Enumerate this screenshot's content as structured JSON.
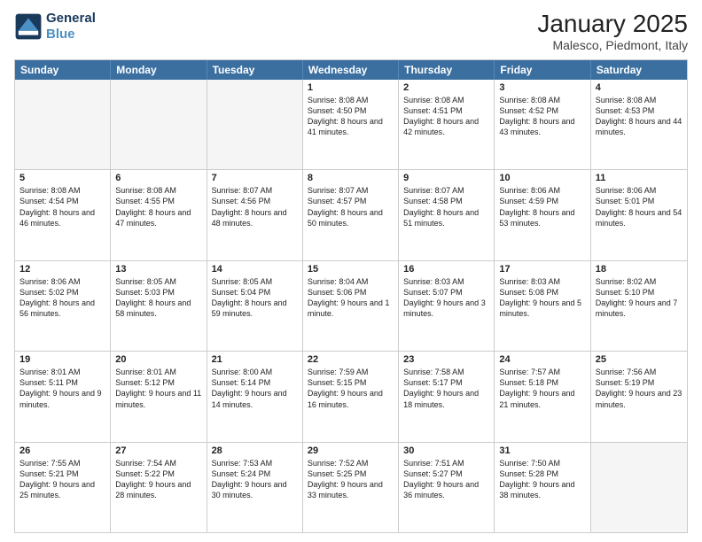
{
  "logo": {
    "line1": "General",
    "line2": "Blue"
  },
  "title": "January 2025",
  "subtitle": "Malesco, Piedmont, Italy",
  "weekdays": [
    "Sunday",
    "Monday",
    "Tuesday",
    "Wednesday",
    "Thursday",
    "Friday",
    "Saturday"
  ],
  "weeks": [
    [
      {
        "day": "",
        "info": "",
        "empty": true
      },
      {
        "day": "",
        "info": "",
        "empty": true
      },
      {
        "day": "",
        "info": "",
        "empty": true
      },
      {
        "day": "1",
        "info": "Sunrise: 8:08 AM\nSunset: 4:50 PM\nDaylight: 8 hours and 41 minutes."
      },
      {
        "day": "2",
        "info": "Sunrise: 8:08 AM\nSunset: 4:51 PM\nDaylight: 8 hours and 42 minutes."
      },
      {
        "day": "3",
        "info": "Sunrise: 8:08 AM\nSunset: 4:52 PM\nDaylight: 8 hours and 43 minutes."
      },
      {
        "day": "4",
        "info": "Sunrise: 8:08 AM\nSunset: 4:53 PM\nDaylight: 8 hours and 44 minutes."
      }
    ],
    [
      {
        "day": "5",
        "info": "Sunrise: 8:08 AM\nSunset: 4:54 PM\nDaylight: 8 hours and 46 minutes."
      },
      {
        "day": "6",
        "info": "Sunrise: 8:08 AM\nSunset: 4:55 PM\nDaylight: 8 hours and 47 minutes."
      },
      {
        "day": "7",
        "info": "Sunrise: 8:07 AM\nSunset: 4:56 PM\nDaylight: 8 hours and 48 minutes."
      },
      {
        "day": "8",
        "info": "Sunrise: 8:07 AM\nSunset: 4:57 PM\nDaylight: 8 hours and 50 minutes."
      },
      {
        "day": "9",
        "info": "Sunrise: 8:07 AM\nSunset: 4:58 PM\nDaylight: 8 hours and 51 minutes."
      },
      {
        "day": "10",
        "info": "Sunrise: 8:06 AM\nSunset: 4:59 PM\nDaylight: 8 hours and 53 minutes."
      },
      {
        "day": "11",
        "info": "Sunrise: 8:06 AM\nSunset: 5:01 PM\nDaylight: 8 hours and 54 minutes."
      }
    ],
    [
      {
        "day": "12",
        "info": "Sunrise: 8:06 AM\nSunset: 5:02 PM\nDaylight: 8 hours and 56 minutes."
      },
      {
        "day": "13",
        "info": "Sunrise: 8:05 AM\nSunset: 5:03 PM\nDaylight: 8 hours and 58 minutes."
      },
      {
        "day": "14",
        "info": "Sunrise: 8:05 AM\nSunset: 5:04 PM\nDaylight: 8 hours and 59 minutes."
      },
      {
        "day": "15",
        "info": "Sunrise: 8:04 AM\nSunset: 5:06 PM\nDaylight: 9 hours and 1 minute."
      },
      {
        "day": "16",
        "info": "Sunrise: 8:03 AM\nSunset: 5:07 PM\nDaylight: 9 hours and 3 minutes."
      },
      {
        "day": "17",
        "info": "Sunrise: 8:03 AM\nSunset: 5:08 PM\nDaylight: 9 hours and 5 minutes."
      },
      {
        "day": "18",
        "info": "Sunrise: 8:02 AM\nSunset: 5:10 PM\nDaylight: 9 hours and 7 minutes."
      }
    ],
    [
      {
        "day": "19",
        "info": "Sunrise: 8:01 AM\nSunset: 5:11 PM\nDaylight: 9 hours and 9 minutes."
      },
      {
        "day": "20",
        "info": "Sunrise: 8:01 AM\nSunset: 5:12 PM\nDaylight: 9 hours and 11 minutes."
      },
      {
        "day": "21",
        "info": "Sunrise: 8:00 AM\nSunset: 5:14 PM\nDaylight: 9 hours and 14 minutes."
      },
      {
        "day": "22",
        "info": "Sunrise: 7:59 AM\nSunset: 5:15 PM\nDaylight: 9 hours and 16 minutes."
      },
      {
        "day": "23",
        "info": "Sunrise: 7:58 AM\nSunset: 5:17 PM\nDaylight: 9 hours and 18 minutes."
      },
      {
        "day": "24",
        "info": "Sunrise: 7:57 AM\nSunset: 5:18 PM\nDaylight: 9 hours and 21 minutes."
      },
      {
        "day": "25",
        "info": "Sunrise: 7:56 AM\nSunset: 5:19 PM\nDaylight: 9 hours and 23 minutes."
      }
    ],
    [
      {
        "day": "26",
        "info": "Sunrise: 7:55 AM\nSunset: 5:21 PM\nDaylight: 9 hours and 25 minutes."
      },
      {
        "day": "27",
        "info": "Sunrise: 7:54 AM\nSunset: 5:22 PM\nDaylight: 9 hours and 28 minutes."
      },
      {
        "day": "28",
        "info": "Sunrise: 7:53 AM\nSunset: 5:24 PM\nDaylight: 9 hours and 30 minutes."
      },
      {
        "day": "29",
        "info": "Sunrise: 7:52 AM\nSunset: 5:25 PM\nDaylight: 9 hours and 33 minutes."
      },
      {
        "day": "30",
        "info": "Sunrise: 7:51 AM\nSunset: 5:27 PM\nDaylight: 9 hours and 36 minutes."
      },
      {
        "day": "31",
        "info": "Sunrise: 7:50 AM\nSunset: 5:28 PM\nDaylight: 9 hours and 38 minutes."
      },
      {
        "day": "",
        "info": "",
        "empty": true
      }
    ]
  ]
}
